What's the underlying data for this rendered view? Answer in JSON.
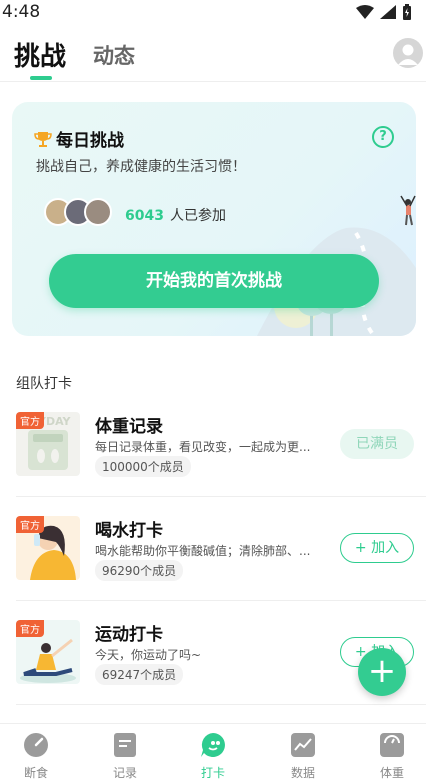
{
  "status": {
    "time": "4:48"
  },
  "header": {
    "tabs": [
      {
        "label": "挑战"
      },
      {
        "label": "动态"
      }
    ]
  },
  "daily": {
    "title": "每日挑战",
    "subtitle": "挑战自己，养成健康的生活习惯！",
    "count": "6043",
    "count_suffix": "人已参加",
    "start_label": "开始我的首次挑战"
  },
  "section_title": "组队打卡",
  "groups": [
    {
      "badge": "官方",
      "title": "体重记录",
      "desc": "每日记录体重，看见改变，一起成为更...",
      "members": "100000个成员",
      "action": "已满员"
    },
    {
      "badge": "官方",
      "title": "喝水打卡",
      "desc": "喝水能帮助你平衡酸碱值；清除肺部、...",
      "members": "96290个成员",
      "action": "+ 加入"
    },
    {
      "badge": "官方",
      "title": "运动打卡",
      "desc": "今天，你运动了吗~",
      "members": "69247个成员",
      "action": "+ 加入"
    }
  ],
  "nav": [
    {
      "label": "断食",
      "icon": "gauge-icon"
    },
    {
      "label": "记录",
      "icon": "notes-icon"
    },
    {
      "label": "打卡",
      "icon": "chat-icon"
    },
    {
      "label": "数据",
      "icon": "chart-icon"
    },
    {
      "label": "体重",
      "icon": "scale-icon"
    }
  ],
  "colors": {
    "accent": "#2ecc8f",
    "badge": "#f06235"
  }
}
